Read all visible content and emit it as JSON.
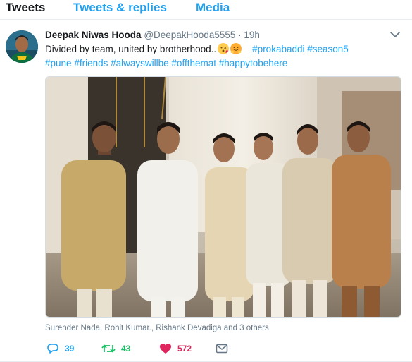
{
  "tabs": [
    "Tweets",
    "Tweets & replies",
    "Media"
  ],
  "tweet": {
    "author_name": "Deepak Niwas Hooda",
    "handle": "@DeepakHooda5555",
    "separator": "·",
    "time": "19h",
    "text": "Divided by team, united by brotherhood..",
    "line1_hashtags": [
      "#prokabaddi",
      "#season5"
    ],
    "line2_hashtags": [
      "#pune",
      "#friends",
      "#alwayswillbe",
      "#offthemat",
      "#happytobehere"
    ],
    "emojis": [
      "face-blowing-kiss-emoji",
      "hugging-face-emoji"
    ],
    "tagged": "Surender Nada, Rohit Kumar., Rishank Devadiga and 3 others",
    "actions": {
      "reply_count": "39",
      "retweet_count": "43",
      "like_count": "572"
    }
  },
  "colors": {
    "link": "#1da1f2",
    "retweet": "#17bf63",
    "like": "#e0245e",
    "muted": "#657786",
    "text": "#14171a"
  }
}
